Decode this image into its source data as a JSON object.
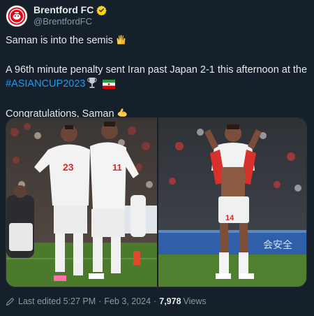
{
  "author": {
    "display_name": "Brentford FC",
    "handle": "@BrentfordFC",
    "avatar_icon": "brentford-crest-icon",
    "verified_icon": "verified-badge-icon",
    "badge_color": "#ffd400"
  },
  "tweet": {
    "line1": "Saman is into the semis",
    "line1_emoji": "raised-hands-icon",
    "line2_prefix": "A 96th minute penalty sent Iran past Japan 2-1 this afternoon at the",
    "hashtag": "#ASIANCUP2023",
    "line2_emojis": [
      "trophy-icon",
      "iran-flag-icon"
    ],
    "line3": "Congratulations, Saman",
    "line3_emoji": "flexed-biceps-icon"
  },
  "media": {
    "photos": [
      {
        "name": "photo-iran-players-celebrating",
        "shirt_numbers": [
          "23",
          "11"
        ]
      },
      {
        "name": "photo-saman-applauding",
        "shirt_number": "14",
        "board_text": "会安全"
      }
    ]
  },
  "footer": {
    "edited_label": "Last edited 5:27 PM",
    "separator": "·",
    "date": "Feb 3, 2024",
    "views_count": "7,978",
    "views_label": "Views"
  },
  "colors": {
    "background": "#15202b",
    "hashtag": "#1d9bf0",
    "muted_text": "#8b98a5",
    "iran_kit": "#f2f2f2",
    "pitch": "#4c7a2c"
  }
}
